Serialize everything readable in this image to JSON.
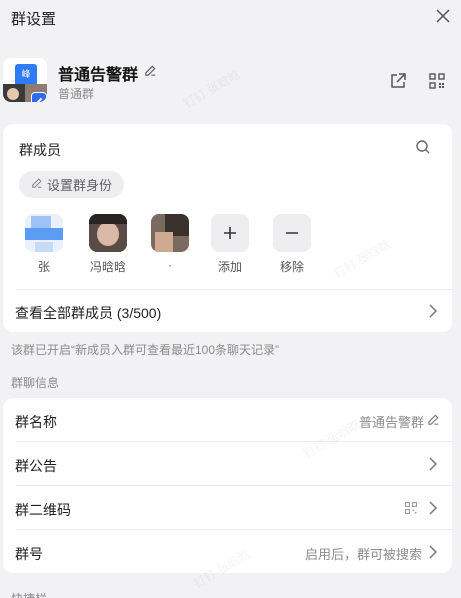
{
  "window": {
    "title": "群设置"
  },
  "group": {
    "name": "普通告警群",
    "type": "普通群",
    "avatar_tag": "峰"
  },
  "members": {
    "title": "群成员",
    "identity_button": "设置群身份",
    "list": [
      {
        "label": "张"
      },
      {
        "label": "冯晗晗"
      },
      {
        "label": "·"
      }
    ],
    "add_label": "添加",
    "remove_label": "移除",
    "view_all": "查看全部群成员 (3/500)"
  },
  "notice": "该群已开启“新成员入群可查看最近100条聊天记录”",
  "info_section": {
    "title": "群聊信息",
    "rows": [
      {
        "key": "群名称",
        "value": "普通告警群"
      },
      {
        "key": "群公告",
        "value": ""
      },
      {
        "key": "群二维码",
        "value": ""
      },
      {
        "key": "群号",
        "value": "启用后，群可被搜索"
      }
    ]
  },
  "bottom_section": {
    "title": "快捷栏"
  },
  "watermark": "钉钉 张晗晗",
  "colors": {
    "accent": "#2f6af7",
    "background": "#f2f2f4",
    "card": "#ffffff"
  },
  "icons": [
    "close-icon",
    "edit-icon",
    "share-icon",
    "qrcode-icon",
    "search-icon",
    "plus-icon",
    "minus-icon",
    "chevron-right-icon"
  ]
}
